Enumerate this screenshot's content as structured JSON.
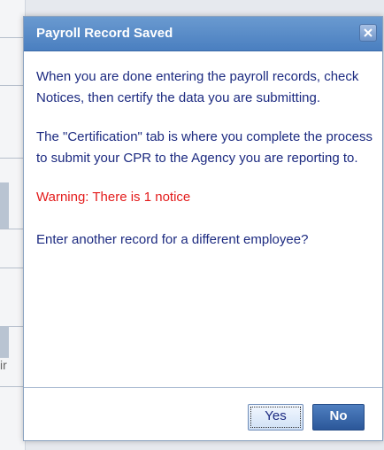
{
  "background": {
    "partial_text": "ir"
  },
  "dialog": {
    "title": "Payroll Record Saved",
    "close_icon": "close-icon",
    "paragraphs": {
      "done_entering": "When you are done entering the payroll records, check Notices, then certify the data you are submitting.",
      "certification_tab": "The \"Certification\" tab is where you complete the process to submit your CPR to the Agency you are reporting to.",
      "warning": "Warning: There is 1 notice",
      "question": "Enter another record for a different employee?"
    },
    "buttons": {
      "yes_label": "Yes",
      "no_label": "No"
    }
  },
  "colors": {
    "title_bar": "#4a7fc0",
    "body_text": "#1c2a80",
    "warning_text": "#e31b1b",
    "no_button": "#2b5799"
  }
}
